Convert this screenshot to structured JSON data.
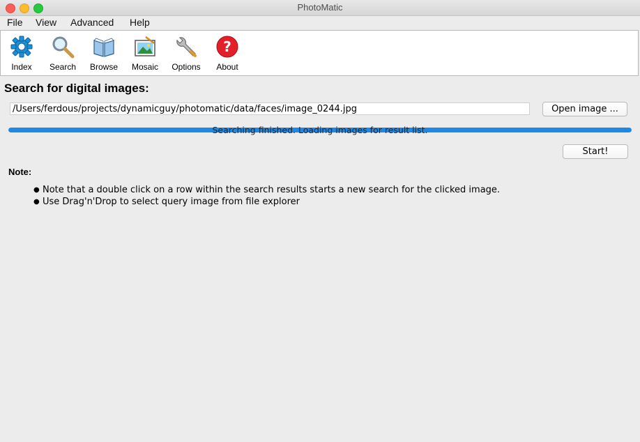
{
  "window": {
    "title": "PhotoMatic"
  },
  "menu": [
    "File",
    "View",
    "Advanced",
    "Help"
  ],
  "toolbar": {
    "index_label": "Index",
    "search_label": "Search",
    "browse_label": "Browse",
    "mosaic_label": "Mosaic",
    "options_label": "Options",
    "about_label": "About"
  },
  "main": {
    "heading": "Search for digital images:",
    "path_value": "/Users/ferdous/projects/dynamicguy/photomatic/data/faces/image_0244.jpg",
    "open_button": "Open image ...",
    "progress": {
      "text": "Searching finished. Loading images for result list.",
      "value": 1.0
    },
    "start_button": "Start!",
    "note_label": "Note:",
    "notes": [
      "Note that a double click on a row within the search results starts a new search for the clicked image.",
      "Use Drag'n'Drop to select query image from file explorer"
    ]
  },
  "colors": {
    "progress": "#1e88e5",
    "accent_red": "#e3202a"
  },
  "icons": [
    "gear-icon",
    "magnifier-icon",
    "book-icon",
    "picture-icon",
    "wrench-icon",
    "question-icon"
  ]
}
